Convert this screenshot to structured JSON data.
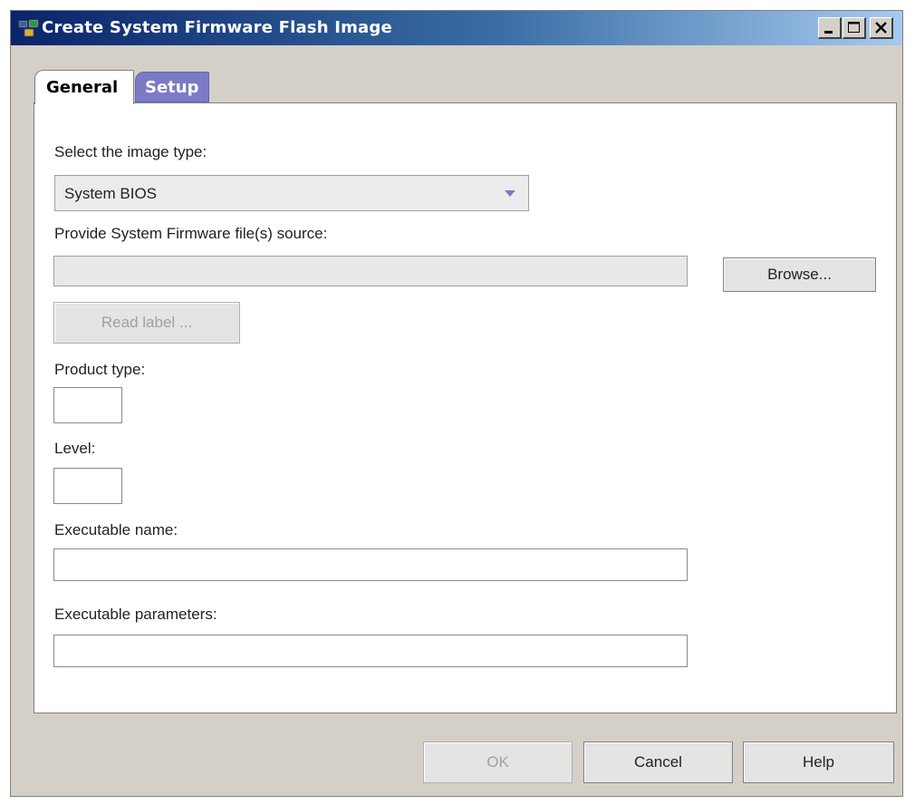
{
  "window": {
    "title": "Create System Firmware Flash Image",
    "controls": [
      "minimize",
      "maximize",
      "close"
    ]
  },
  "tabs": [
    {
      "label": "General",
      "active": true
    },
    {
      "label": "Setup",
      "active": false
    }
  ],
  "form": {
    "image_type_label": "Select the image type:",
    "image_type_value": "System BIOS",
    "source_label": "Provide System Firmware file(s) source:",
    "source_value": "",
    "browse_label": "Browse...",
    "read_label_label": "Read label ...",
    "product_type_label": "Product type:",
    "product_type_value": "",
    "level_label": "Level:",
    "level_value": "",
    "exec_name_label": "Executable name:",
    "exec_name_value": "",
    "exec_params_label": "Executable parameters:",
    "exec_params_value": ""
  },
  "footer": {
    "ok_label": "OK",
    "cancel_label": "Cancel",
    "help_label": "Help"
  },
  "colors": {
    "title_bar_start": "#0a246a",
    "title_bar_end": "#a6caf0",
    "setup_tab": "#7b7bc4",
    "window_bg": "#d4d0c8"
  }
}
